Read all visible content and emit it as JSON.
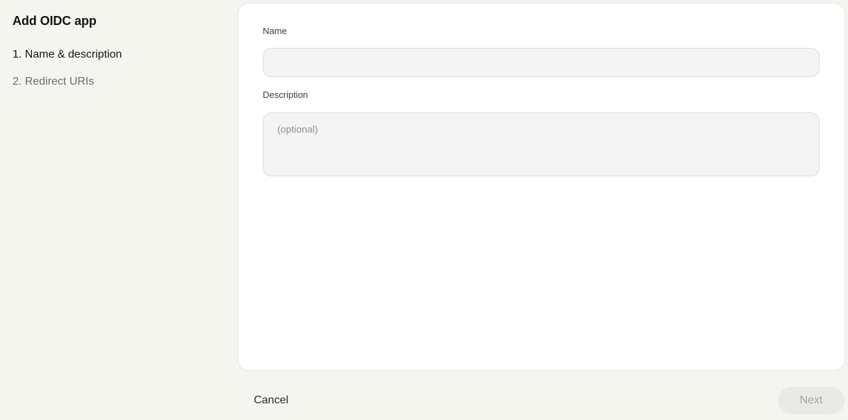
{
  "wizard": {
    "title": "Add OIDC app",
    "steps": [
      {
        "label": "1. Name & description",
        "state": "active"
      },
      {
        "label": "2. Redirect URIs",
        "state": "inactive"
      }
    ]
  },
  "form": {
    "name": {
      "label": "Name",
      "value": "",
      "placeholder": ""
    },
    "description": {
      "label": "Description",
      "value": "",
      "placeholder": "(optional)"
    }
  },
  "footer": {
    "cancel_label": "Cancel",
    "next_label": "Next"
  },
  "colors": {
    "page_background": "#f5f5f0",
    "card_background": "#ffffff",
    "input_background": "#f4f4f4",
    "active_step": "#141414",
    "inactive_step": "#6b6b68",
    "next_disabled_bg": "#e9e9e5",
    "next_disabled_text": "#a3a39f"
  }
}
